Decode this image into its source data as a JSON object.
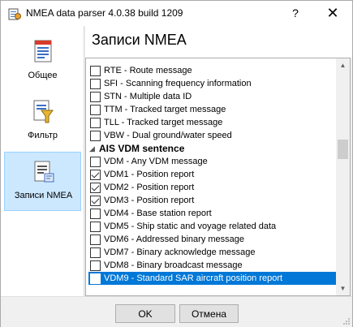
{
  "window": {
    "title": "NMEA data parser 4.0.38 build 1209",
    "help_glyph": "?",
    "close_glyph": "✕"
  },
  "nav": {
    "items": [
      {
        "label": "Общее",
        "icon": "document-icon"
      },
      {
        "label": "Фильтр",
        "icon": "filter-icon"
      },
      {
        "label": "Записи NMEA",
        "icon": "records-icon",
        "active": true
      }
    ]
  },
  "page": {
    "title": "Записи NMEA"
  },
  "list": {
    "rows": [
      {
        "label": "RTE - Route message",
        "checked": false
      },
      {
        "label": "SFI - Scanning frequency information",
        "checked": false
      },
      {
        "label": "STN - Multiple data ID",
        "checked": false
      },
      {
        "label": "TTM - Tracked target message",
        "checked": false
      },
      {
        "label": "TLL - Tracked target message",
        "checked": false
      },
      {
        "label": "VBW - Dual ground/water speed",
        "checked": false
      }
    ],
    "group": {
      "label": "AIS VDM sentence",
      "expander": "◢"
    },
    "group_rows": [
      {
        "label": "VDM - Any VDM message",
        "checked": false
      },
      {
        "label": "VDM1 - Position report",
        "checked": true
      },
      {
        "label": "VDM2 - Position report",
        "checked": true
      },
      {
        "label": "VDM3 - Position report",
        "checked": true
      },
      {
        "label": "VDM4 - Base station report",
        "checked": false
      },
      {
        "label": "VDM5 - Ship static and voyage related data",
        "checked": false
      },
      {
        "label": "VDM6 - Addressed binary message",
        "checked": false
      },
      {
        "label": "VDM7 - Binary acknowledge message",
        "checked": false
      },
      {
        "label": "VDM8 - Binary broadcast message",
        "checked": false
      },
      {
        "label": "VDM9 - Standard SAR aircraft position report",
        "checked": false,
        "selected": true
      }
    ]
  },
  "footer": {
    "ok_label": "OK",
    "cancel_label": "Отмена"
  },
  "colors": {
    "selection": "#0078d7",
    "nav_active": "#cce8ff"
  }
}
